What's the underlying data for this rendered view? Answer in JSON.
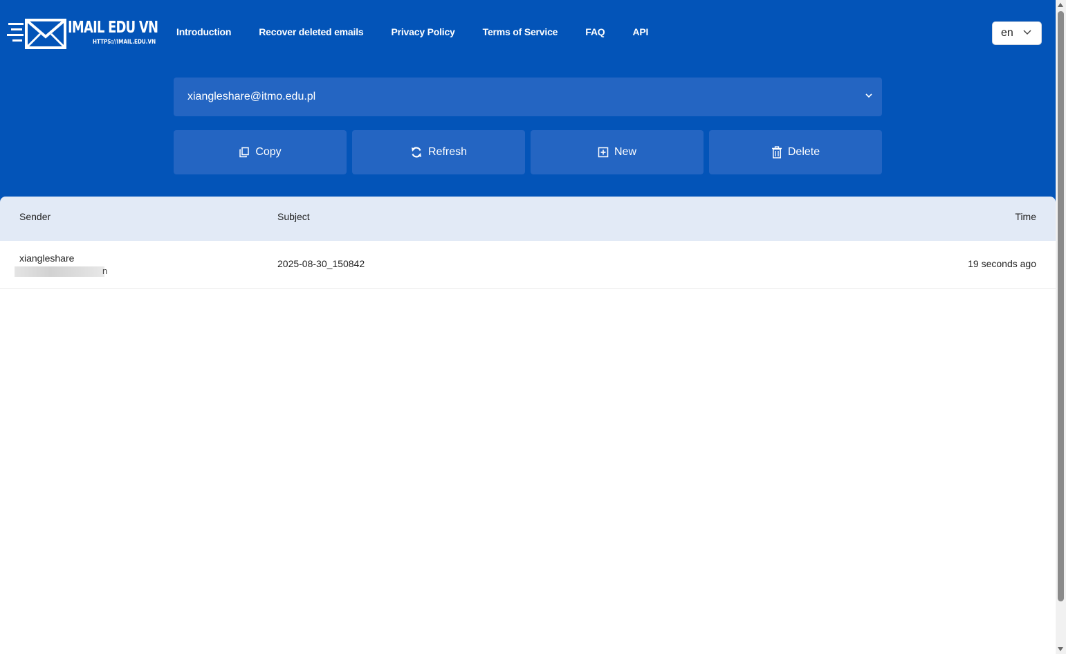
{
  "brand": {
    "title": "IMAIL EDU VN",
    "subtitle": "HTTPS://IMAIL.EDU.VN"
  },
  "nav": {
    "items": [
      {
        "label": "Introduction"
      },
      {
        "label": "Recover deleted emails"
      },
      {
        "label": "Privacy Policy"
      },
      {
        "label": "Terms of Service"
      },
      {
        "label": "FAQ"
      },
      {
        "label": "API"
      }
    ]
  },
  "language": {
    "selected": "en"
  },
  "mailbox": {
    "address": "xiangleshare@itmo.edu.pl"
  },
  "actions": {
    "copy_label": "Copy",
    "refresh_label": "Refresh",
    "new_label": "New",
    "delete_label": "Delete"
  },
  "inbox": {
    "columns": {
      "sender": "Sender",
      "subject": "Subject",
      "time": "Time"
    },
    "rows": [
      {
        "sender_name": "xiangleshare",
        "sender_tail": "n",
        "subject": "2025-08-30_150842",
        "time": "19 seconds ago"
      }
    ]
  },
  "colors": {
    "header_bg": "#0354b8",
    "button_bg": "#2465c2",
    "table_head_bg": "#e2eaf6"
  }
}
